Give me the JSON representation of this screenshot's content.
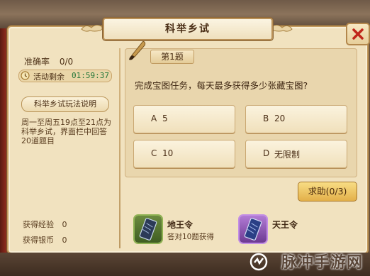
{
  "dialog": {
    "title": "科举乡试",
    "close_icon": "close-icon"
  },
  "status": {
    "accuracy_label": "准确率",
    "accuracy_value": "0/0",
    "timer_label": "活动剩余",
    "timer_value": "01:59:37",
    "rules_button": "科举乡试玩法说明",
    "rules_text": "周一至周五19点至21点为科举乡试，界面栏中回答20道题目"
  },
  "rewards_summary": [
    {
      "label": "获得经验",
      "value": "0"
    },
    {
      "label": "获得银币",
      "value": "0"
    }
  ],
  "question": {
    "number_label": "第1题",
    "text": "完成宝图任务，每天最多获得多少张藏宝图?",
    "options": [
      {
        "letter": "A",
        "value": "5"
      },
      {
        "letter": "B",
        "value": "20"
      },
      {
        "letter": "C",
        "value": "10"
      },
      {
        "letter": "D",
        "value": "无限制"
      }
    ]
  },
  "help_button": "求助(0/3)",
  "reward_items": [
    {
      "name": "地王令",
      "desc": "答对10题获得",
      "icon": "scroll-icon",
      "color": "#5e7d35"
    },
    {
      "name": "天王令",
      "desc": "",
      "icon": "scroll-icon",
      "color": "#9a62c4"
    }
  ],
  "watermark": "脉冲手游网"
}
